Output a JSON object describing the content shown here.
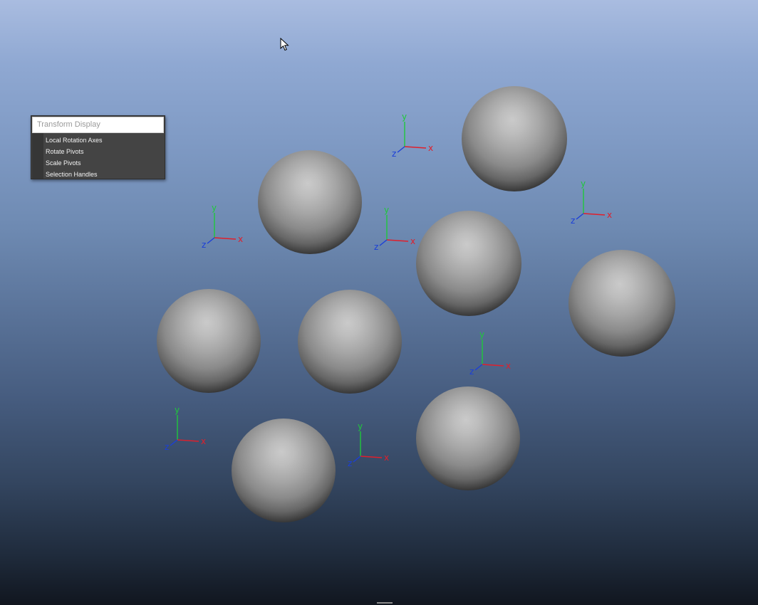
{
  "viewport": {
    "name": "perspective-viewport"
  },
  "colors": {
    "axis_x": "#e01f2b",
    "axis_y": "#1fc83b",
    "axis_z": "#1b3fd8",
    "sphere_light": "#c9c9c9",
    "sphere_dark": "#2a2a2a"
  },
  "axis_labels": {
    "x": "x",
    "y": "y",
    "z": "z"
  },
  "transform_display_menu": {
    "title": "Transform Display",
    "items": [
      {
        "label": "Local Rotation Axes"
      },
      {
        "label": "Rotate Pivots"
      },
      {
        "label": "Scale Pivots"
      },
      {
        "label": "Selection Handles"
      }
    ]
  },
  "icons": {
    "cursor": "arrow-cursor-icon"
  }
}
